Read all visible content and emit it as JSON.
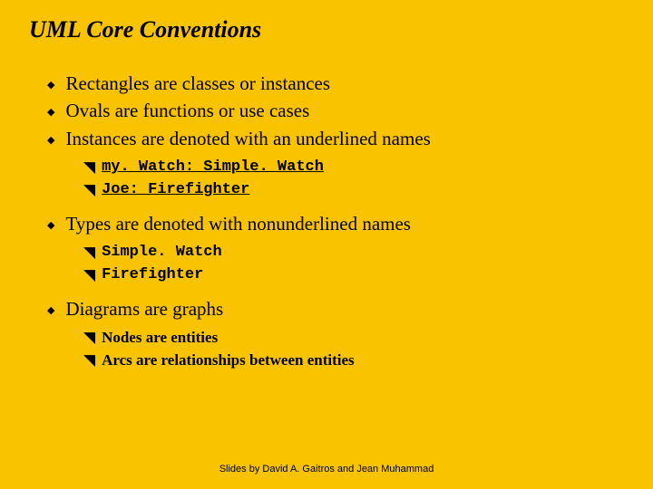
{
  "title": "UML Core Conventions",
  "items": {
    "b1": "Rectangles are classes or instances",
    "b2": "Ovals are functions or use cases",
    "b3": "Instances are denoted with an underlined names",
    "b3_sub1": "my. Watch: Simple. Watch",
    "b3_sub2": "Joe: Firefighter",
    "b4": "Types are denoted with nonunderlined names",
    "b4_sub1": "Simple. Watch",
    "b4_sub2": "Firefighter",
    "b5": "Diagrams are graphs",
    "b5_sub1": "Nodes are entities",
    "b5_sub2": "Arcs are relationships between entities"
  },
  "footer": "Slides by David A. Gaitros and Jean Muhammad"
}
